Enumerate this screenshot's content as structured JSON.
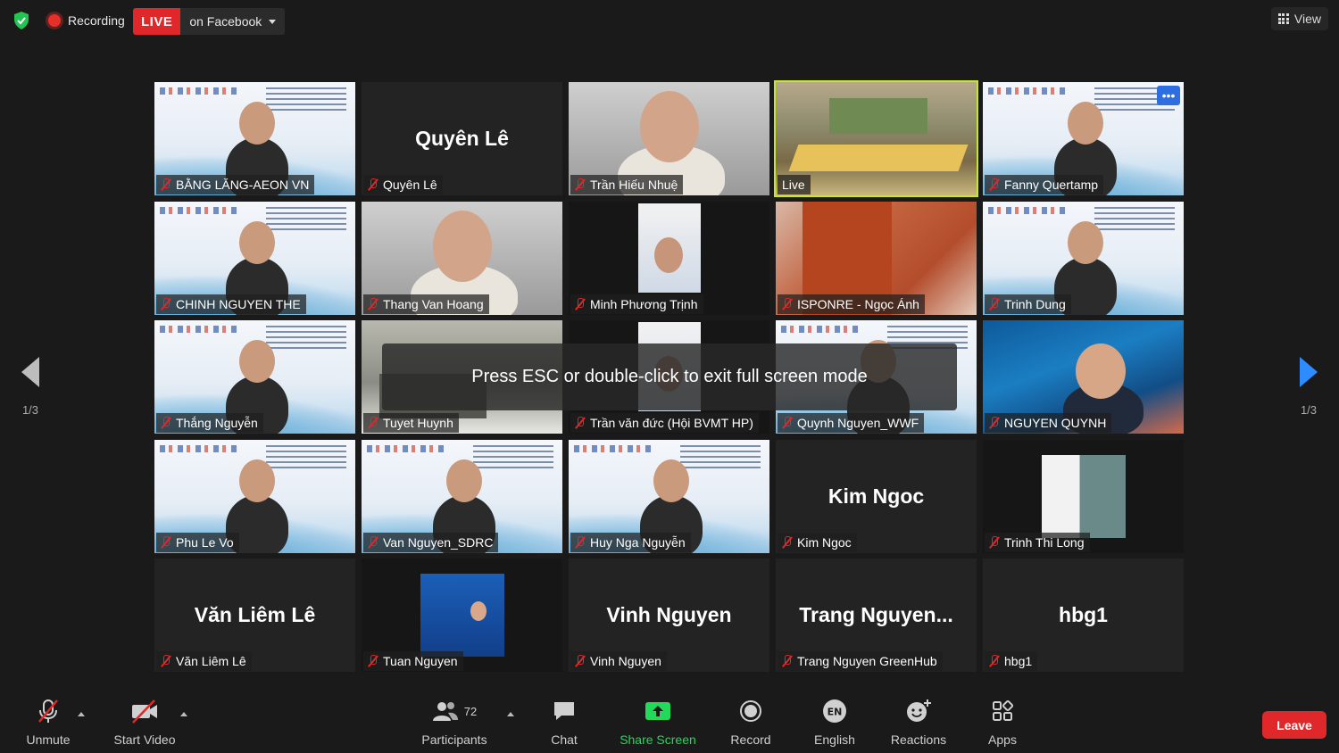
{
  "topbar": {
    "recording_label": "Recording",
    "live_label": "LIVE",
    "live_destination": "on Facebook",
    "view_label": "View"
  },
  "nav": {
    "left_page": "1/3",
    "right_page": "1/3"
  },
  "overlay_text": "Press ESC or double-click to exit full screen mode",
  "tiles": [
    {
      "name": "BẰNG LĂNG-AEON VN",
      "big": "",
      "video": "banner"
    },
    {
      "name": "Quyên Lê",
      "big": "Quyên Lê",
      "video": "none"
    },
    {
      "name": "Trần Hiếu Nhuệ",
      "big": "",
      "video": "gray"
    },
    {
      "name": "Live",
      "big": "",
      "video": "room"
    },
    {
      "name": "Fanny Quertamp",
      "big": "",
      "video": "banner"
    },
    {
      "name": "CHINH NGUYEN THE",
      "big": "",
      "video": "banner"
    },
    {
      "name": "Thang Van Hoang",
      "big": "",
      "video": "gray"
    },
    {
      "name": "Minh Phương Trịnh",
      "big": "",
      "video": "dark"
    },
    {
      "name": "ISPONRE - Ngọc Ánh",
      "big": "",
      "video": "red"
    },
    {
      "name": "Trinh Dung",
      "big": "",
      "video": "banner"
    },
    {
      "name": "Thắng Nguyễn",
      "big": "",
      "video": "banner"
    },
    {
      "name": "Tuyet Huynh",
      "big": "",
      "video": "lab"
    },
    {
      "name": "Trần văn đức (Hội BVMT HP)",
      "big": "",
      "video": "dark"
    },
    {
      "name": "Quynh Nguyen_WWF",
      "big": "",
      "video": "banner"
    },
    {
      "name": "NGUYEN QUYNH",
      "big": "",
      "video": "ocean"
    },
    {
      "name": "Phu Le Vo",
      "big": "",
      "video": "banner"
    },
    {
      "name": "Van Nguyen_SDRC",
      "big": "",
      "video": "banner"
    },
    {
      "name": "Huy Nga Nguyễn",
      "big": "",
      "video": "banner"
    },
    {
      "name": "Kim Ngoc",
      "big": "Kim Ngoc",
      "video": "none"
    },
    {
      "name": "Trinh Thi Long",
      "big": "",
      "video": "photo"
    },
    {
      "name": "Văn Liêm Lê",
      "big": "Văn Liêm Lê",
      "video": "none"
    },
    {
      "name": "Tuan Nguyen",
      "big": "",
      "video": "un"
    },
    {
      "name": "Vinh Nguyen",
      "big": "Vinh Nguyen",
      "video": "none"
    },
    {
      "name": "Trang Nguyen GreenHub",
      "big": "Trang  Nguyen...",
      "video": "none"
    },
    {
      "name": "hbg1",
      "big": "hbg1",
      "video": "none"
    }
  ],
  "toolbar": {
    "unmute": "Unmute",
    "start_video": "Start Video",
    "participants": "Participants",
    "participants_count": "72",
    "chat": "Chat",
    "share_screen": "Share Screen",
    "record": "Record",
    "language": "English",
    "language_code": "EN",
    "reactions": "Reactions",
    "apps": "Apps",
    "leave": "Leave"
  },
  "colors": {
    "live_red": "#e0282a",
    "active_speaker": "#c5e82e",
    "share_green": "#23d959",
    "nav_blue": "#2d8cff"
  }
}
